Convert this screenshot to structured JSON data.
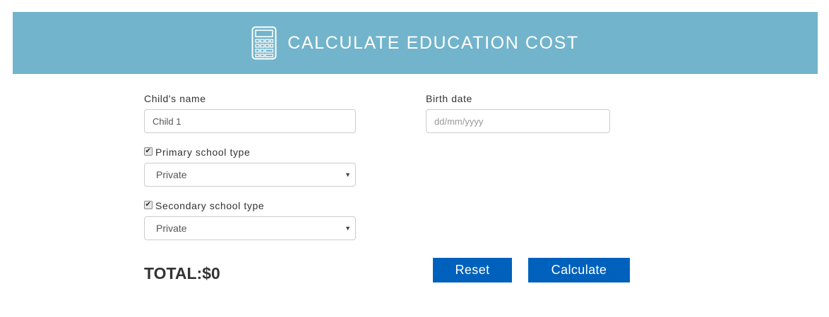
{
  "header": {
    "title": "CALCULATE EDUCATION COST",
    "icon": "calculator-icon",
    "background_color": "#72b4cb"
  },
  "form": {
    "child_name": {
      "label": "Child's name",
      "value": "Child 1"
    },
    "birth_date": {
      "label": "Birth date",
      "value": "",
      "placeholder": "dd/mm/yyyy"
    },
    "primary_school": {
      "label": "Primary school type",
      "checked": true,
      "selected": "Private"
    },
    "secondary_school": {
      "label": "Secondary school type",
      "checked": true,
      "selected": "Private"
    }
  },
  "summary": {
    "total_label": "TOTAL:",
    "total_value": "$0"
  },
  "buttons": {
    "reset_label": "Reset",
    "calculate_label": "Calculate",
    "color": "#0061bd"
  }
}
